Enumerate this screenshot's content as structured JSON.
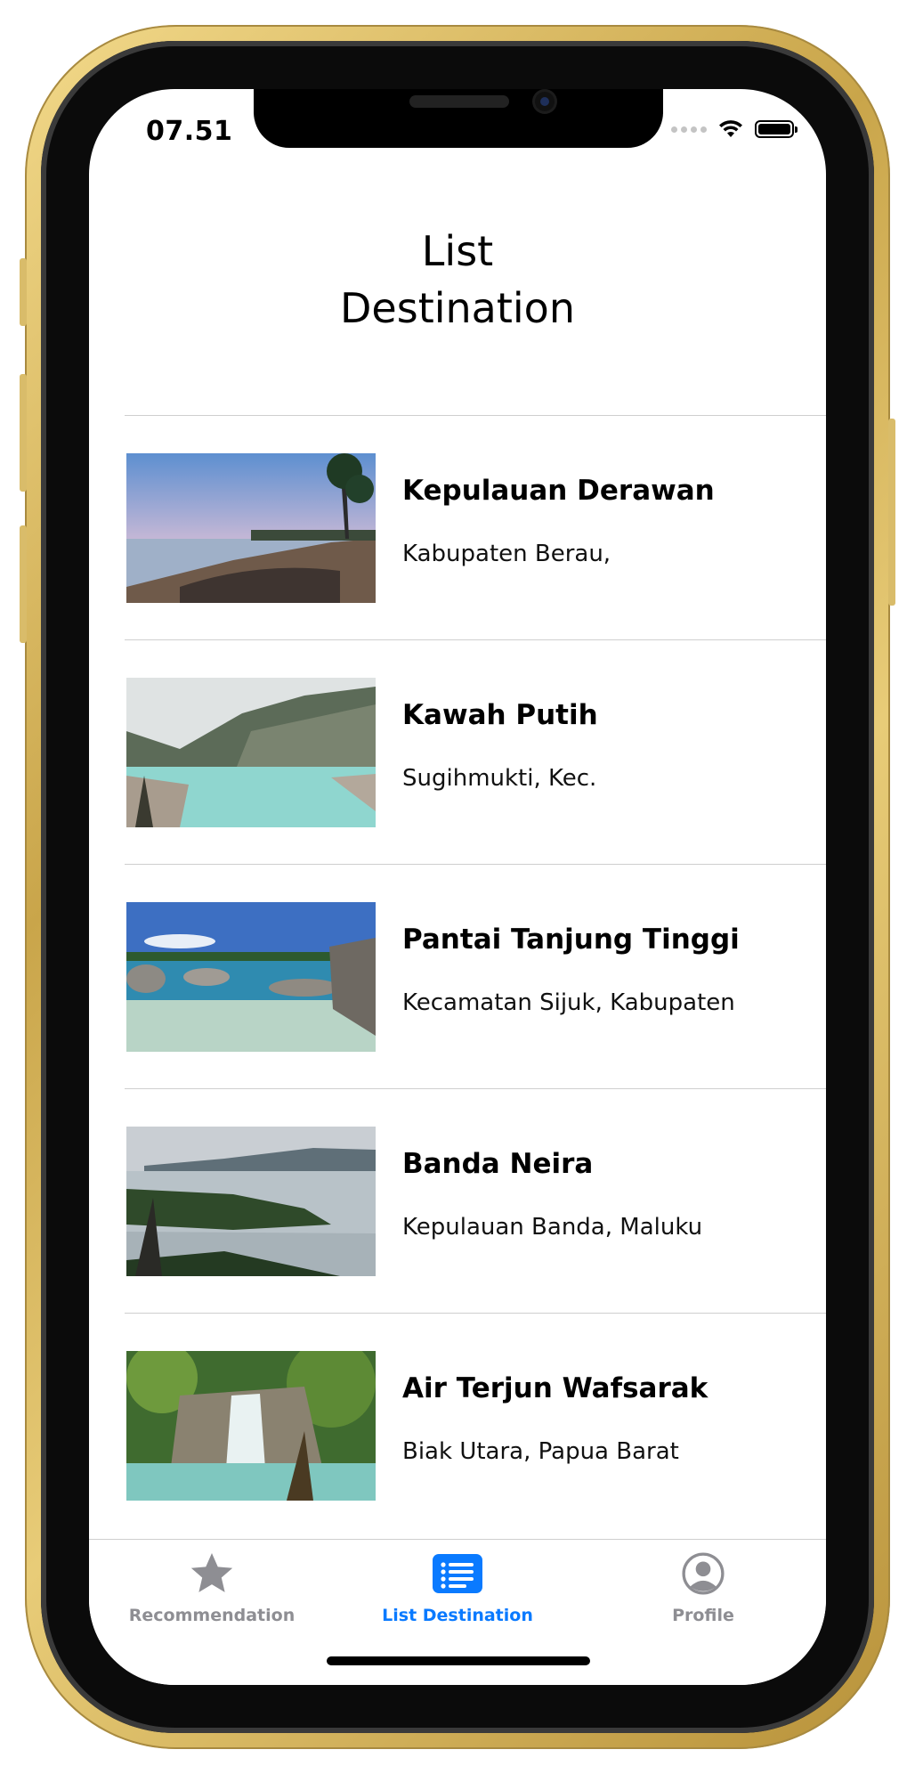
{
  "status_bar": {
    "time": "07.51"
  },
  "header": {
    "title": "List\nDestination"
  },
  "destinations": [
    {
      "name": "Kepulauan Derawan",
      "location": "Kabupaten Berau,"
    },
    {
      "name": "Kawah Putih",
      "location": "Sugihmukti, Kec."
    },
    {
      "name": "Pantai Tanjung Tinggi",
      "location": "Kecamatan Sijuk, Kabupaten"
    },
    {
      "name": "Banda Neira",
      "location": "Kepulauan Banda, Maluku"
    },
    {
      "name": "Air Terjun Wafsarak",
      "location": "Biak Utara, Papua Barat"
    }
  ],
  "tabbar": {
    "tabs": [
      {
        "label": "Recommendation",
        "icon": "star-icon",
        "active": false
      },
      {
        "label": "List Destination",
        "icon": "list-icon",
        "active": true
      },
      {
        "label": "Profile",
        "icon": "person-circle-icon",
        "active": false
      }
    ]
  },
  "colors": {
    "accent": "#0a7aff",
    "inactive": "#8e8e93",
    "separator": "#cfcfcf",
    "frame_gold": "#d4b25a"
  }
}
